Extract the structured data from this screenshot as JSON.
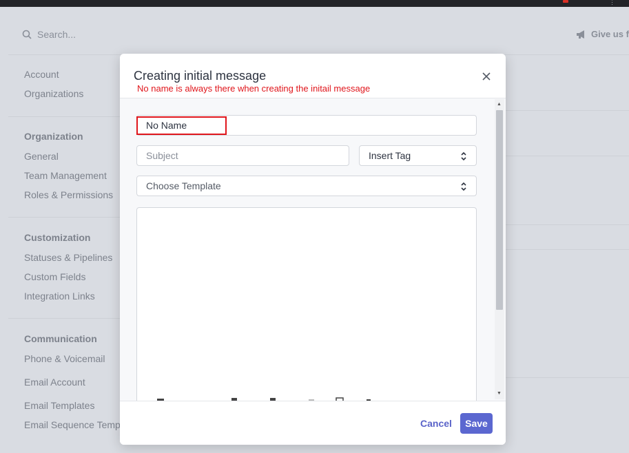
{
  "browser": {
    "url_fragment": "...",
    "menu_glyph": "⋮"
  },
  "header": {
    "search_placeholder": "Search...",
    "feedback_label": "Give us fe"
  },
  "sidebar": {
    "account_group": [
      "Account",
      "Organizations"
    ],
    "organization": {
      "heading": "Organization",
      "items": [
        "General",
        "Team Management",
        "Roles & Permissions"
      ]
    },
    "customization": {
      "heading": "Customization",
      "items": [
        "Statuses & Pipelines",
        "Custom Fields",
        "Integration Links"
      ]
    },
    "communication": {
      "heading": "Communication",
      "items": [
        "Phone & Voicemail",
        "Email Account",
        "Email Templates",
        "Email Sequence Templ"
      ]
    }
  },
  "modal": {
    "title": "Creating initial message",
    "annotation": "No name is always there when creating the initail message",
    "name_field_value": "No Name",
    "subject_placeholder": "Subject",
    "insert_tag_label": "Insert Tag",
    "choose_template_label": "Choose Template",
    "cancel_label": "Cancel",
    "save_label": "Save"
  },
  "colors": {
    "accent": "#5b67d0",
    "annotation_red": "#e0151b",
    "background": "#d9dce2"
  },
  "icons": [
    "search-icon",
    "megaphone-icon",
    "close-icon",
    "updown-chevron-icon"
  ]
}
